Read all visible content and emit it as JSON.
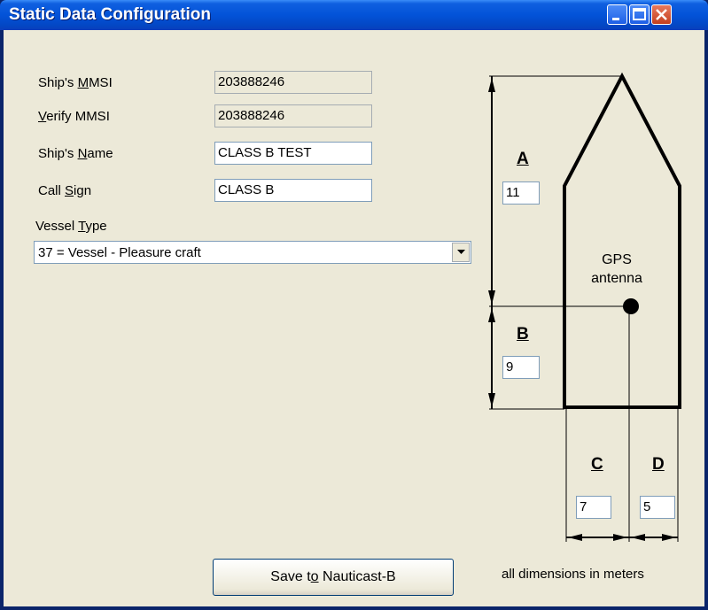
{
  "window": {
    "title": "Static Data Configuration",
    "controls": [
      "minimize-icon",
      "maximize-icon",
      "close-icon"
    ]
  },
  "form": {
    "mmsi": {
      "label_pre": "Ship's ",
      "label_key": "M",
      "label_post": "MSI",
      "value": "203888246"
    },
    "verify_mmsi": {
      "label_pre": "",
      "label_key": "V",
      "label_post": "erify MMSI",
      "value": "203888246"
    },
    "ship_name": {
      "label_pre": "Ship's ",
      "label_key": "N",
      "label_post": "ame",
      "value": "CLASS B TEST"
    },
    "call_sign": {
      "label_pre": "Call ",
      "label_key": "S",
      "label_post": "ign",
      "value": "CLASS B"
    },
    "vessel_type": {
      "label_pre": "Vessel ",
      "label_key": "T",
      "label_post": "ype",
      "value": "37 = Vessel - Pleasure craft"
    }
  },
  "dimensions": {
    "A": {
      "label": "A",
      "value": "11"
    },
    "B": {
      "label": "B",
      "value": "9"
    },
    "C": {
      "label": "C",
      "value": "7"
    },
    "D": {
      "label": "D",
      "value": "5"
    },
    "gps_line1": "GPS",
    "gps_line2": "antenna",
    "note": "all dimensions in meters"
  },
  "save_button": {
    "label_pre": "Save t",
    "label_key": "o",
    "label_post": " Nauticast-B"
  },
  "colors": {
    "titlebar": "#0353d8",
    "face": "#ece9d8",
    "close": "#c4401e"
  }
}
